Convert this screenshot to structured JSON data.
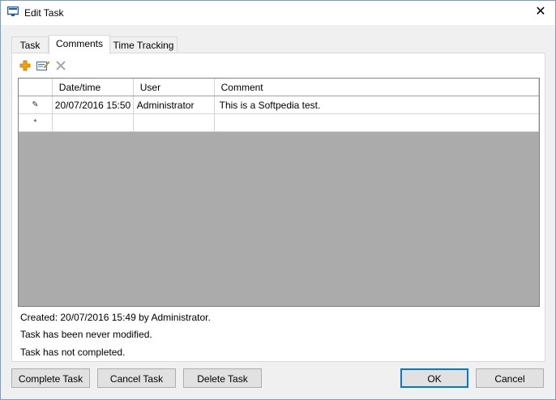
{
  "window": {
    "title": "Edit Task",
    "close_glyph": "✕"
  },
  "tabs": [
    {
      "label": "Task",
      "active": false
    },
    {
      "label": "Comments",
      "active": true
    },
    {
      "label": "Time Tracking",
      "active": false
    }
  ],
  "toolbar": {
    "add_icon": "plus-icon",
    "edit_icon": "edit-icon",
    "delete_icon": "delete-icon"
  },
  "grid": {
    "columns": [
      "Date/time",
      "User",
      "Comment"
    ],
    "rows": [
      {
        "marker": "✎",
        "datetime": "20/07/2016 15:50",
        "user": "Administrator",
        "comment": "This is a Softpedia test."
      }
    ],
    "new_row_marker": "*"
  },
  "info": {
    "created": "Created: 20/07/2016  15:49 by Administrator.",
    "modified": "Task has been never modified.",
    "completed": "Task has not completed."
  },
  "buttons": {
    "complete": "Complete Task",
    "cancel_task": "Cancel Task",
    "delete": "Delete Task",
    "ok": "OK",
    "cancel": "Cancel"
  },
  "colors": {
    "accent": "#0078d7",
    "grid_empty": "#ababab",
    "add_icon": "#f5a300"
  }
}
